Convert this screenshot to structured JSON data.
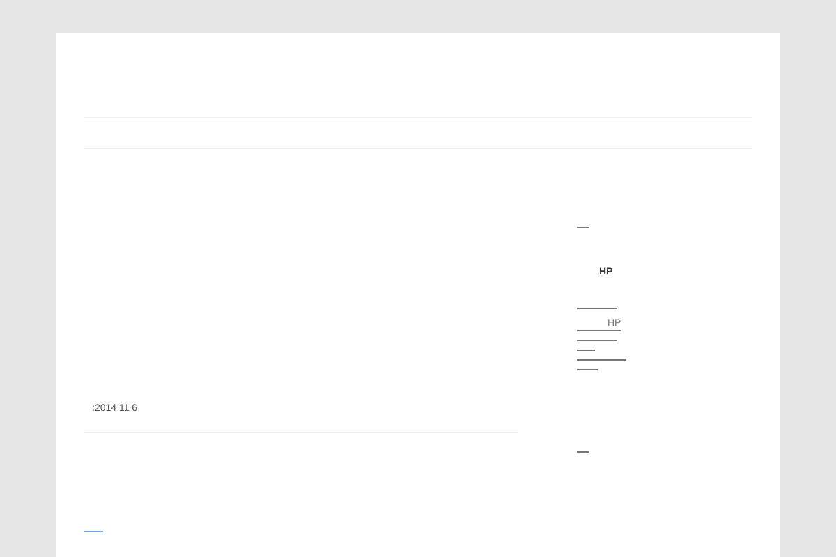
{
  "post": {
    "date": ":2014 11 6"
  },
  "sidebar": {
    "items": [
      {
        "kind": "line"
      },
      {
        "kind": "heading",
        "text": "HP"
      },
      {
        "kind": "line"
      },
      {
        "kind": "link",
        "text": "HP"
      },
      {
        "kind": "line"
      },
      {
        "kind": "line"
      },
      {
        "kind": "line"
      },
      {
        "kind": "line"
      }
    ]
  },
  "footer_link": {
    "kind": "line"
  }
}
